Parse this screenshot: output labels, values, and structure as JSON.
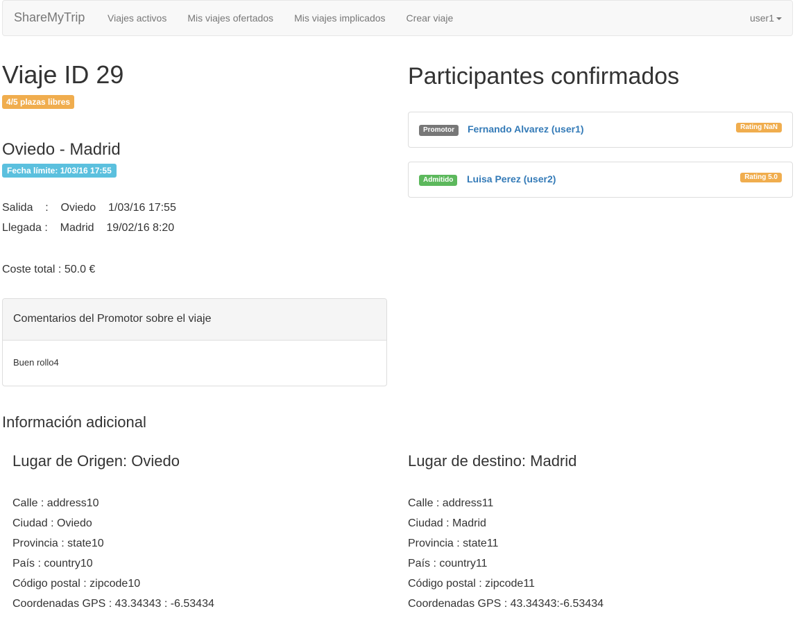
{
  "navbar": {
    "brand": "ShareMyTrip",
    "links": [
      "Viajes activos",
      "Mis viajes ofertados",
      "Mis viajes implicados",
      "Crear viaje"
    ],
    "user": "user1"
  },
  "trip": {
    "title": "Viaje ID 29",
    "seats_badge": "4/5 plazas libres",
    "route": "Oviedo - Madrid",
    "deadline_badge": "Fecha límite: 1/03/16 17:55",
    "departure": {
      "label": "Salida",
      "city": "Oviedo",
      "datetime": "1/03/16 17:55"
    },
    "arrival": {
      "label": "Llegada",
      "city": "Madrid",
      "datetime": "19/02/16 8:20"
    },
    "total_cost_label": "Coste total",
    "total_cost": "50.0 €"
  },
  "comments_panel": {
    "heading": "Comentarios del Promotor sobre el viaje",
    "body": "Buen rollo4"
  },
  "additional_info": {
    "heading": "Información adicional",
    "origin": {
      "title": "Lugar de Origen: Oviedo",
      "street": "Calle : address10",
      "city": "Ciudad : Oviedo",
      "state": "Provincia : state10",
      "country": "País : country10",
      "zipcode": "Código postal : zipcode10",
      "gps": "Coordenadas GPS : 43.34343 : -6.53434"
    },
    "destination": {
      "title": "Lugar de destino: Madrid",
      "street": "Calle : address11",
      "city": "Ciudad : Madrid",
      "state": "Provincia : state11",
      "country": "País : country11",
      "zipcode": "Código postal : zipcode11",
      "gps": "Coordenadas GPS : 43.34343:-6.53434"
    }
  },
  "participants": {
    "title": "Participantes confirmados",
    "items": [
      {
        "role": "Promotor",
        "name": "Fernando Alvarez (user1)",
        "rating": "Rating NaN"
      },
      {
        "role": "Admitido",
        "name": "Luisa Perez (user2)",
        "rating": "Rating 5.0"
      }
    ]
  },
  "colors": {
    "link": "#337ab7",
    "warning": "#f0ad4e",
    "info": "#5bc0de",
    "success": "#5cb85c",
    "default": "#777777"
  }
}
